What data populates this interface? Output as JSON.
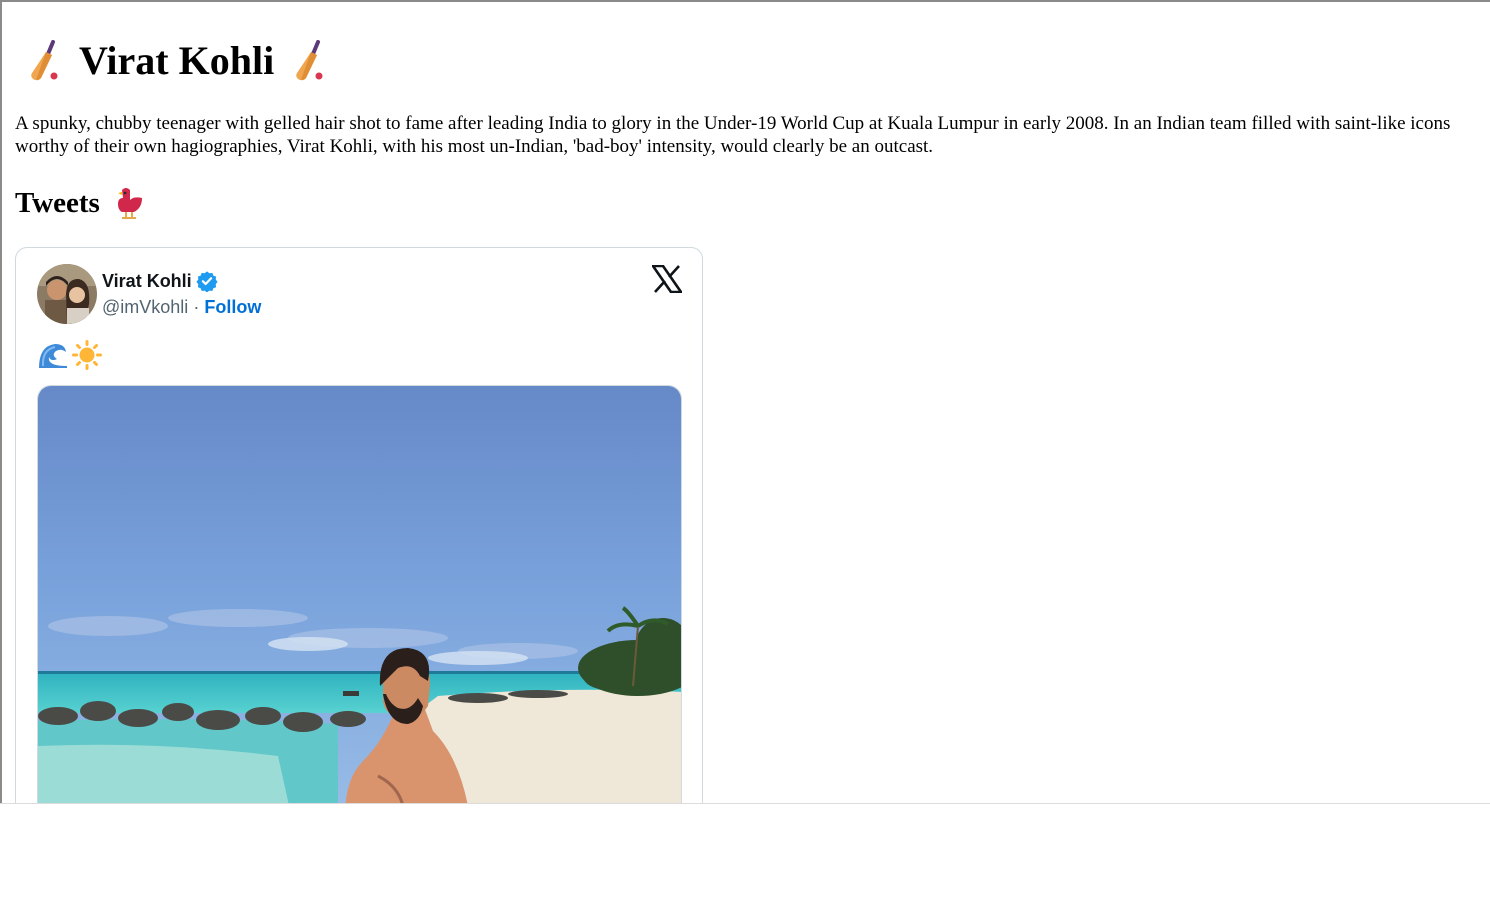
{
  "page": {
    "title": "Virat Kohli",
    "intro": "A spunky, chubby teenager with gelled hair shot to fame after leading India to glory in the Under-19 World Cup at Kuala Lumpur in early 2008. In an Indian team filled with saint-like icons worthy of their own hagiographies, Virat Kohli, with his most un-Indian, 'bad-boy' intensity, would clearly be an outcast.",
    "section_title": "Tweets"
  },
  "tweet": {
    "author_name": "Virat Kohli",
    "handle": "@imVkohli",
    "separator": "·",
    "follow_label": "Follow",
    "icons": [
      "cricket-bat-icon",
      "bird-icon",
      "verified-badge-icon",
      "x-logo-icon",
      "wave-emoji-icon",
      "sun-emoji-icon"
    ],
    "verified_color": "#1d9bf0",
    "link_color": "#006fd6"
  }
}
